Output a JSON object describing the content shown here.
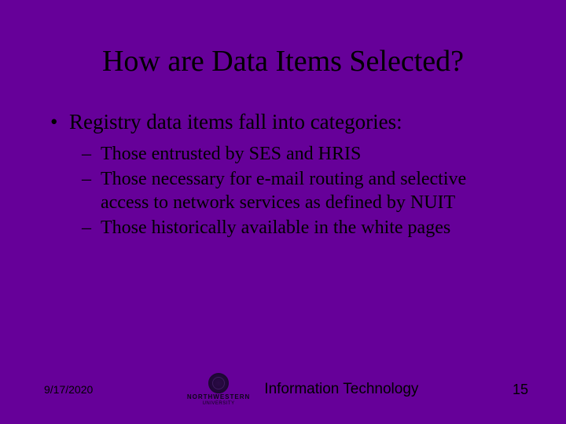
{
  "title": "How are Data Items Selected?",
  "bullets": {
    "level1": [
      {
        "text": "Registry data items fall into categories:"
      }
    ],
    "level2": [
      {
        "text": "Those entrusted by SES and HRIS"
      },
      {
        "text": "Those necessary for e-mail routing and selective access to network services as defined by NUIT"
      },
      {
        "text": "Those historically available in the white pages"
      }
    ]
  },
  "footer": {
    "date": "9/17/2020",
    "university_name": "NORTHWESTERN",
    "university_sub": "UNIVERSITY",
    "department": "Information Technology",
    "page_number": "15"
  }
}
